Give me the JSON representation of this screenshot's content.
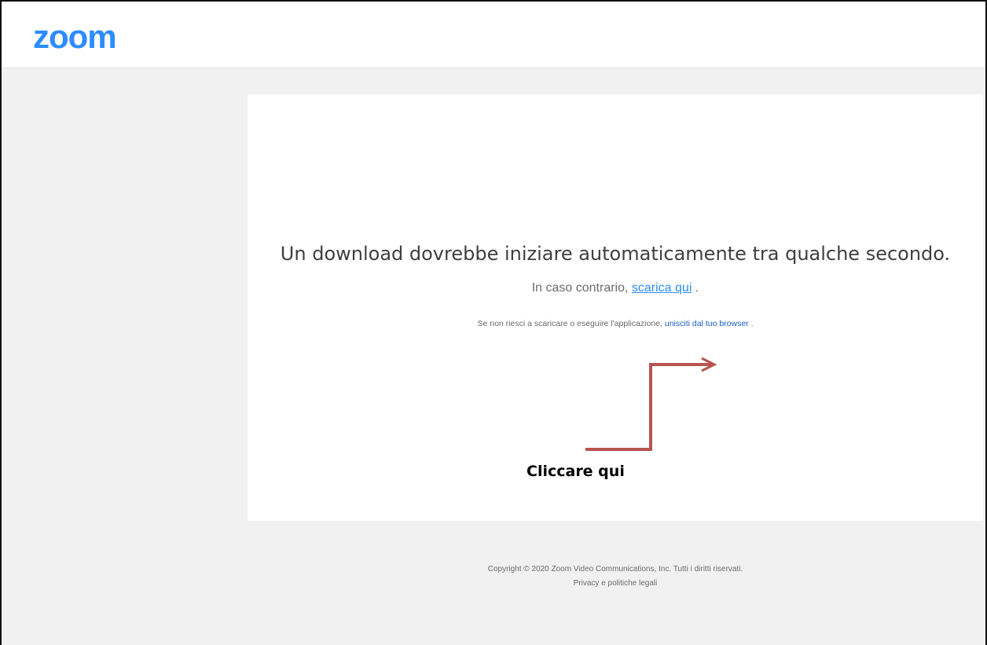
{
  "header": {
    "logo_text": "zoom",
    "brand_color": "#2d8cff"
  },
  "card": {
    "headline": "Un download dovrebbe iniziare automaticamente tra qualche secondo.",
    "fallback_prefix": "In caso contrario, ",
    "download_link": "scarica qui",
    "fallback_suffix": " .",
    "browser_prefix": "Se non riesci a scaricare o eseguire l'applicazione, ",
    "browser_link": "unisciti dal tuo browser",
    "browser_suffix": " ."
  },
  "annotation": {
    "text": "Cliccare qui",
    "arrow_color": "#b85450"
  },
  "footer": {
    "copyright": "Copyright © 2020 Zoom Video Communications, Inc. Tutti i diritti riservati.",
    "legal_link": "Privacy e politiche legali"
  }
}
